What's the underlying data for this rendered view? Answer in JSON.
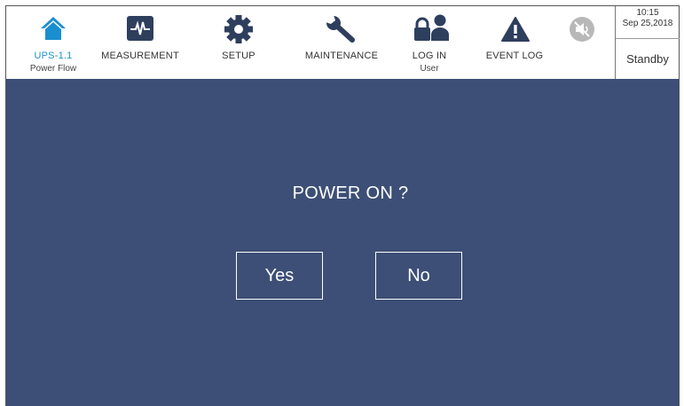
{
  "nav": {
    "home": {
      "label": "UPS-1.1",
      "sub": "Power Flow",
      "icon": "home-icon"
    },
    "measurement": {
      "label": "MEASUREMENT",
      "icon": "waveform-icon"
    },
    "setup": {
      "label": "SETUP",
      "icon": "gear-icon"
    },
    "maintenance": {
      "label": "MAINTENANCE",
      "icon": "wrench-icon"
    },
    "login": {
      "label": "LOG IN",
      "sub": "User",
      "icon": "lock-user-icon"
    },
    "eventlog": {
      "label": "EVENT LOG",
      "icon": "warning-icon"
    },
    "mute": {
      "icon": "speaker-mute-icon"
    }
  },
  "status": {
    "time": "10:15",
    "date": "Sep 25,2018",
    "mode": "Standby"
  },
  "dialog": {
    "prompt": "POWER ON ?",
    "yes_label": "Yes",
    "no_label": "No"
  },
  "colors": {
    "accent": "#1a8fd0",
    "background": "#3d4f76",
    "icon_dark": "#2e3f5e"
  }
}
